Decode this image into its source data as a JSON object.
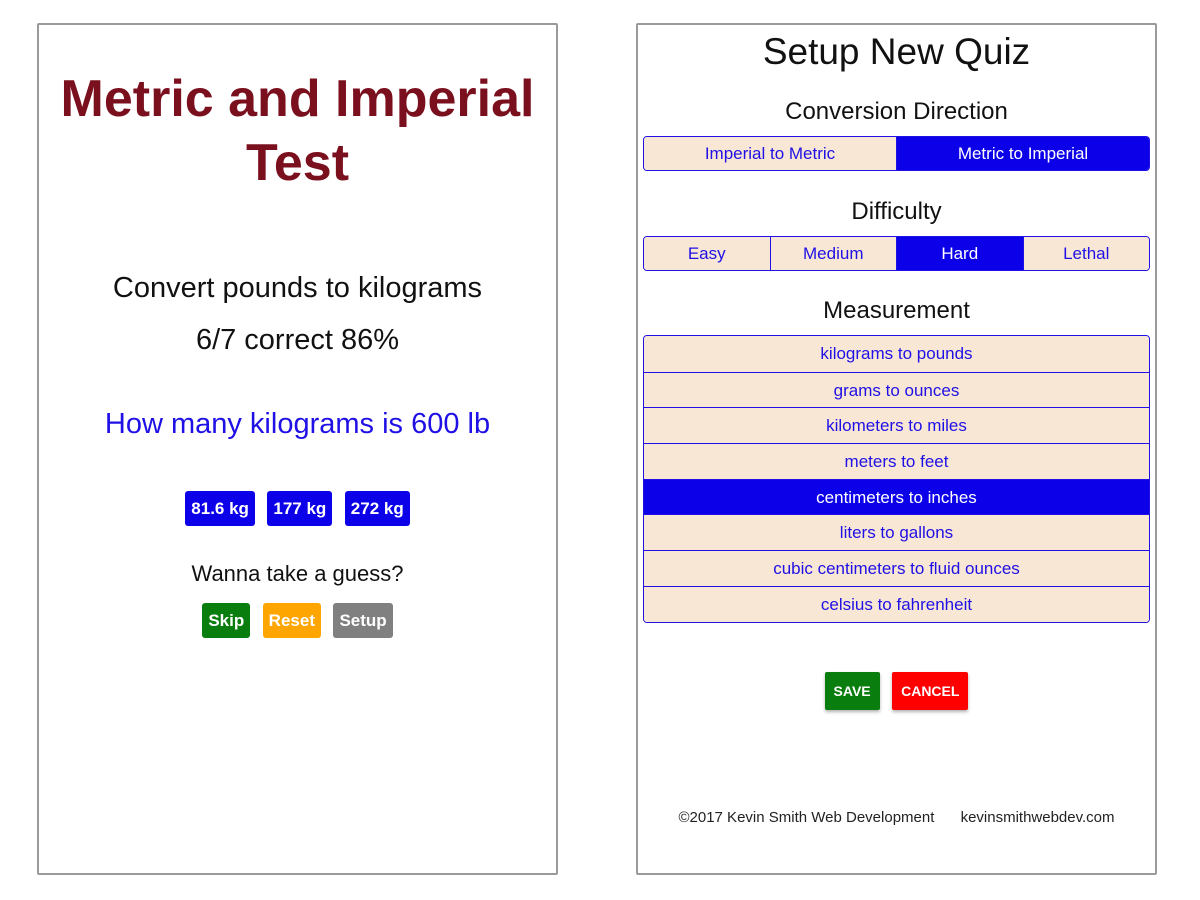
{
  "quiz": {
    "title": "Metric and Imperial Test",
    "conversion": "Convert pounds to kilograms",
    "score": "6/7 correct 86%",
    "question": "How many kilograms is 600 lb",
    "answers": [
      "81.6 kg",
      "177 kg",
      "272 kg"
    ],
    "guess_prompt": "Wanna take a guess?",
    "controls": {
      "skip": "Skip",
      "reset": "Reset",
      "setup": "Setup"
    }
  },
  "setup": {
    "title": "Setup New Quiz",
    "direction": {
      "heading": "Conversion Direction",
      "options": [
        "Imperial to Metric",
        "Metric to Imperial"
      ],
      "selected": "Metric to Imperial"
    },
    "difficulty": {
      "heading": "Difficulty",
      "options": [
        "Easy",
        "Medium",
        "Hard",
        "Lethal"
      ],
      "selected": "Hard"
    },
    "measurement": {
      "heading": "Measurement",
      "options": [
        "kilograms to pounds",
        "grams to ounces",
        "kilometers to miles",
        "meters to feet",
        "centimeters to inches",
        "liters to gallons",
        "cubic centimeters to fluid ounces",
        "celsius to fahrenheit"
      ],
      "selected": "centimeters to inches"
    },
    "save_label": "SAVE",
    "cancel_label": "CANCEL"
  },
  "footer": {
    "copyright": "©2017 Kevin Smith Web Development",
    "website": "kevinsmithwebdev.com"
  },
  "colors": {
    "title": "#7a0f1e",
    "accent_blue": "#0c00e8",
    "link_blue": "#1f10e6",
    "option_bg": "#f8e7d4",
    "skip": "#0a7d0f",
    "reset": "#ffa500",
    "setup": "#808080",
    "save": "#0a7d0f",
    "cancel": "#ff0000"
  }
}
